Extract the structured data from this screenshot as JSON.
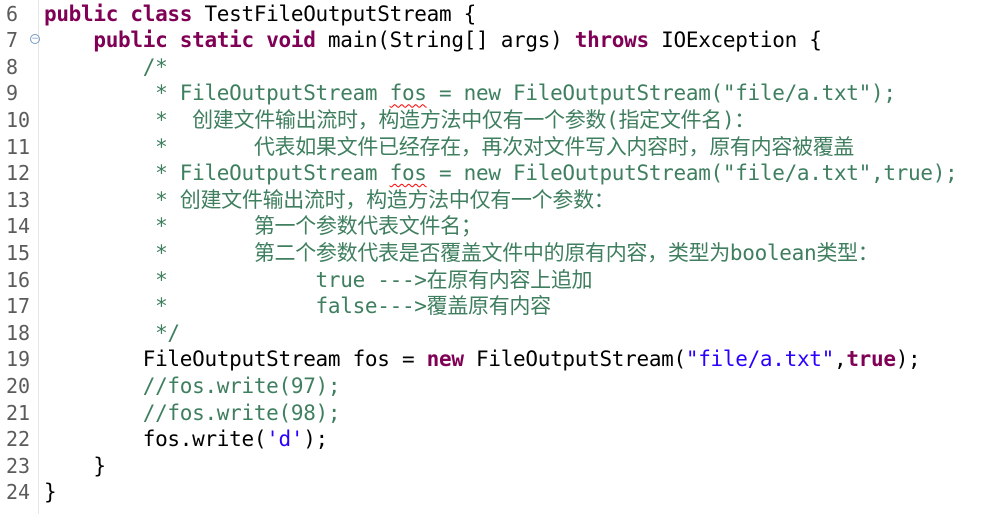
{
  "lines": [
    {
      "num": "6",
      "segs": [
        {
          "t": "public",
          "c": "kw"
        },
        {
          "t": " ",
          "c": "plain"
        },
        {
          "t": "class",
          "c": "kw"
        },
        {
          "t": " TestFileOutputStream {",
          "c": "plain"
        }
      ]
    },
    {
      "num": "7",
      "fold": true,
      "segs": [
        {
          "t": "    ",
          "c": "plain"
        },
        {
          "t": "public",
          "c": "kw"
        },
        {
          "t": " ",
          "c": "plain"
        },
        {
          "t": "static",
          "c": "kw"
        },
        {
          "t": " ",
          "c": "plain"
        },
        {
          "t": "void",
          "c": "kw"
        },
        {
          "t": " main(String[] args) ",
          "c": "plain"
        },
        {
          "t": "throws",
          "c": "kw"
        },
        {
          "t": " IOException {",
          "c": "plain"
        }
      ]
    },
    {
      "num": "8",
      "segs": [
        {
          "t": "        /*",
          "c": "cm"
        }
      ]
    },
    {
      "num": "9",
      "segs": [
        {
          "t": "         * FileOutputStream ",
          "c": "cm"
        },
        {
          "t": "fos",
          "c": "cm squiggle"
        },
        {
          "t": " = new FileOutputStream(\"file/a.txt\");",
          "c": "cm"
        }
      ]
    },
    {
      "num": "10",
      "segs": [
        {
          "t": "         *  创建文件输出流时，构造方法中仅有一个参数(指定文件名)：",
          "c": "cm"
        }
      ]
    },
    {
      "num": "11",
      "segs": [
        {
          "t": "         *       代表如果文件已经存在，再次对文件写入内容时，原有内容被覆盖",
          "c": "cm"
        }
      ]
    },
    {
      "num": "12",
      "segs": [
        {
          "t": "         * FileOutputStream ",
          "c": "cm"
        },
        {
          "t": "fos",
          "c": "cm squiggle"
        },
        {
          "t": " = new FileOutputStream(\"file/a.txt\",true);",
          "c": "cm"
        }
      ]
    },
    {
      "num": "13",
      "segs": [
        {
          "t": "         * 创建文件输出流时，构造方法中仅有一个参数：",
          "c": "cm"
        }
      ]
    },
    {
      "num": "14",
      "segs": [
        {
          "t": "         *       第一个参数代表文件名；",
          "c": "cm"
        }
      ]
    },
    {
      "num": "15",
      "segs": [
        {
          "t": "         *       第二个参数代表是否覆盖文件中的原有内容，类型为boolean类型：",
          "c": "cm"
        }
      ]
    },
    {
      "num": "16",
      "segs": [
        {
          "t": "         *            true --->在原有内容上追加",
          "c": "cm"
        }
      ]
    },
    {
      "num": "17",
      "segs": [
        {
          "t": "         *            false--->覆盖原有内容",
          "c": "cm"
        }
      ]
    },
    {
      "num": "18",
      "segs": [
        {
          "t": "         */",
          "c": "cm"
        }
      ]
    },
    {
      "num": "19",
      "segs": [
        {
          "t": "        FileOutputStream fos = ",
          "c": "plain"
        },
        {
          "t": "new",
          "c": "kw"
        },
        {
          "t": " FileOutputStream(",
          "c": "plain"
        },
        {
          "t": "\"file/a.txt\"",
          "c": "str"
        },
        {
          "t": ",",
          "c": "plain"
        },
        {
          "t": "true",
          "c": "kw"
        },
        {
          "t": ");",
          "c": "plain"
        }
      ]
    },
    {
      "num": "20",
      "segs": [
        {
          "t": "        //fos.write(97);",
          "c": "cm"
        }
      ]
    },
    {
      "num": "21",
      "segs": [
        {
          "t": "        //fos.write(98);",
          "c": "cm"
        }
      ]
    },
    {
      "num": "22",
      "segs": [
        {
          "t": "        fos.write(",
          "c": "plain"
        },
        {
          "t": "'d'",
          "c": "str"
        },
        {
          "t": ");",
          "c": "plain"
        }
      ]
    },
    {
      "num": "23",
      "segs": [
        {
          "t": "    }",
          "c": "plain"
        }
      ]
    },
    {
      "num": "24",
      "segs": [
        {
          "t": "}",
          "c": "plain"
        }
      ]
    }
  ],
  "colors": {
    "keyword": "#7f0055",
    "comment": "#3f7f5f",
    "string": "#2a00ff",
    "line_number": "#5b5b5b",
    "background": "#ffffff"
  }
}
